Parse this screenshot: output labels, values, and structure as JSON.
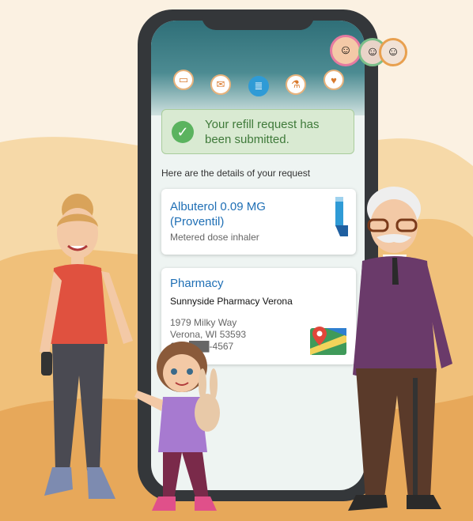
{
  "app": {
    "tabs": [
      {
        "icon": "wallet-icon",
        "glyph": "▭"
      },
      {
        "icon": "mail-icon",
        "glyph": "✉"
      },
      {
        "icon": "list-icon",
        "glyph": "≣"
      },
      {
        "icon": "flask-icon",
        "glyph": "⚗"
      },
      {
        "icon": "heart-clipboard-icon",
        "glyph": "♥"
      }
    ],
    "avatars": [
      "woman-avatar",
      "grandma-avatar",
      "grandpa-avatar"
    ]
  },
  "banner": {
    "message": "Your refill request has been submitted."
  },
  "details_heading": "Here are the details of your request",
  "medication": {
    "name": "Albuterol 0.09 MG (Proventil)",
    "form": "Metered dose inhaler"
  },
  "pharmacy": {
    "title": "Pharmacy",
    "name": "Sunnyside Pharmacy Verona",
    "address_line1": "1979 Milky Way",
    "address_line2": "Verona, WI 53593",
    "phone": "608-███-4567"
  },
  "colors": {
    "accent_blue": "#1f6fb5",
    "success_green": "#5bb35f",
    "tab_orange": "#e7b27c"
  }
}
